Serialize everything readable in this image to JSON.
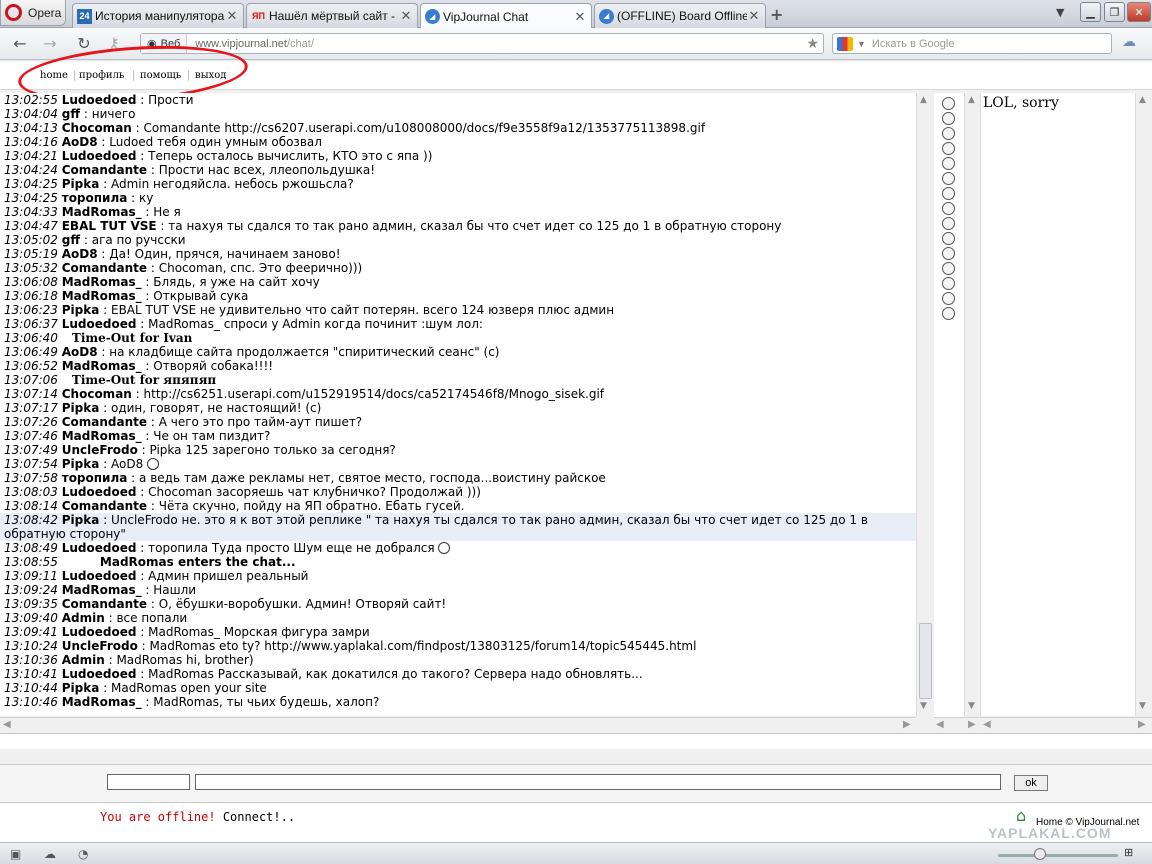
{
  "browser": {
    "menu_label": "Opera",
    "tabs": [
      {
        "icon": "24",
        "label": "История манипулятора ..."
      },
      {
        "icon": "ЯП",
        "label": "Нашёл мёртвый сайт - ..."
      },
      {
        "icon": "vj",
        "label": "VipJournal Chat"
      },
      {
        "icon": "vj",
        "label": "(OFFLINE) Board Offline ..."
      }
    ],
    "new_tab": "+",
    "tab_list": "▼",
    "address_badge": "Веб",
    "url_host": "www.vipjournal.net",
    "url_path": "/chat/",
    "search_placeholder": "Искать в Google",
    "zoom_label": "⊞"
  },
  "site_nav": {
    "home": "home",
    "profile": "профиль",
    "help": "помощь",
    "logout": "выход"
  },
  "chat": [
    {
      "time": "13:02:55",
      "user": "Ludoedoed",
      "text": " : Прости"
    },
    {
      "time": "13:04:04",
      "user": "gff",
      "text": " : ничего"
    },
    {
      "time": "13:04:13",
      "user": "Chocoman",
      "text": " :  Comandante http://cs6207.userapi.com/u108008000/docs/f9e3558f9a12/1353775113898.gif"
    },
    {
      "time": "13:04:16",
      "user": "AoD8",
      "text": " : Ludoed тебя один умным обозвал"
    },
    {
      "time": "13:04:21",
      "user": "Ludoedoed",
      "text": " : Теперь осталось вычислить, КТО это с япа ))"
    },
    {
      "time": "13:04:24",
      "user": "Comandante",
      "text": " : Прости нас всех, ллеопольдушка!"
    },
    {
      "time": "13:04:25",
      "user": "Pipka",
      "text": " :  Admin негодяйсла. небось ржошьсла?"
    },
    {
      "time": "13:04:25",
      "user": "торопила",
      "text": " : ку"
    },
    {
      "time": "13:04:33",
      "user": "MadRomas_",
      "text": " : Не я"
    },
    {
      "time": "13:04:47",
      "user": "EBAL TUT VSE",
      "text": " : та нахуя ты сдался то так рано админ, сказал бы что счет идет со 125 до 1 в обратную сторону"
    },
    {
      "time": "13:05:02",
      "user": "gff",
      "text": " : ага по ручсски"
    },
    {
      "time": "13:05:19",
      "user": "AoD8",
      "text": " : Да! Один, прячся, начинаем заново!"
    },
    {
      "time": "13:05:32",
      "user": "Comandante",
      "text": " :  Chocoman, спс. Это феерично)))"
    },
    {
      "time": "13:06:08",
      "user": "MadRomas_",
      "text": " : Блядь, я уже на сайт хочу"
    },
    {
      "time": "13:06:18",
      "user": "MadRomas_",
      "text": " : Открывай сука"
    },
    {
      "time": "13:06:23",
      "user": "Pipka",
      "text": " :  EBAL TUT VSE не удивительно что сайт потерян. всего 124 юзверя плюс админ"
    },
    {
      "time": "13:06:37",
      "user": "Ludoedoed",
      "text": " :  MadRomas_ спроси у Admin когда починит :шум лол:"
    },
    {
      "time": "13:06:40",
      "system": "Time-Out for Ivan"
    },
    {
      "time": "13:06:49",
      "user": "AoD8",
      "text": " : на кладбище сайта продолжается \"спиритический сеанс\" (с)"
    },
    {
      "time": "13:06:52",
      "user": "MadRomas_",
      "text": " : Отворяй собака!!!!"
    },
    {
      "time": "13:07:06",
      "system": "Time-Out for япяпяп"
    },
    {
      "time": "13:07:14",
      "user": "Chocoman",
      "text": " : http://cs6251.userapi.com/u152919514/docs/ca52174546f8/Mnogo_sisek.gif"
    },
    {
      "time": "13:07:17",
      "user": "Pipka",
      "text": " : один, говорят, не настоящий! (с)"
    },
    {
      "time": "13:07:26",
      "user": "Comandante",
      "text": " : А чего это про тайм-аут пишет?"
    },
    {
      "time": "13:07:46",
      "user": "MadRomas_",
      "text": " : Че он там пиздит?"
    },
    {
      "time": "13:07:49",
      "user": "UncleFrodo",
      "text": " :  Pipka 125 зарегоно только за сегодня?"
    },
    {
      "time": "13:07:54",
      "user": "Pipka",
      "text": " :  AoD8 ",
      "smile": true
    },
    {
      "time": "13:07:58",
      "user": "торопила",
      "text": " : а ведь там даже рекламы нет, святое место, господа...воистину райское"
    },
    {
      "time": "13:08:03",
      "user": "Ludoedoed",
      "text": " :  Chocoman засоряешь чат клубничко? Продолжай )))"
    },
    {
      "time": "13:08:14",
      "user": "Comandante",
      "text": " : Чёта скучно, пойду на ЯП обратно. Ебать гусей."
    },
    {
      "time": "13:08:42",
      "user": "Pipka",
      "text": " :  UncleFrodo не. это я к вот этой реплике \" та нахуя ты сдался то так рано админ, сказал бы что счет идет со 125 до 1 в обратную сторону\"",
      "highlight": true
    },
    {
      "time": "13:08:49",
      "user": "Ludoedoed",
      "text": " :  торопила Туда просто Шум еще не добрался ",
      "smile": true
    },
    {
      "time": "13:08:55",
      "enter": "MadRomas enters the chat..."
    },
    {
      "time": "13:09:11",
      "user": "Ludoedoed",
      "text": " : Админ пришел реальный"
    },
    {
      "time": "13:09:24",
      "user": "MadRomas_",
      "text": " : Нашли"
    },
    {
      "time": "13:09:35",
      "user": "Comandante",
      "text": " : О, ёбушки-воробушки. Админ! Отворяй сайт!"
    },
    {
      "time": "13:09:40",
      "user": "Admin",
      "text": " : все попали"
    },
    {
      "time": "13:09:41",
      "user": "Ludoedoed",
      "text": " :  MadRomas_ Морская фигура замри"
    },
    {
      "time": "13:10:24",
      "user": "UncleFrodo",
      "text": " :  MadRomas eto ty? http://www.yaplakal.com/findpost/13803125/forum14/topic545445.html"
    },
    {
      "time": "13:10:36",
      "user": "Admin",
      "text": " :  MadRomas hi, brother)"
    },
    {
      "time": "13:10:41",
      "user": "Ludoedoed",
      "text": " :  MadRomas Рассказывай, как докатился до такого? Сервера надо обновлять..."
    },
    {
      "time": "13:10:44",
      "user": "Pipka",
      "text": " :  MadRomas open your site"
    },
    {
      "time": "13:10:46",
      "user": "MadRomas_",
      "text": " : MadRomas, ты чьих будешь, халоп?"
    }
  ],
  "users_panel": {
    "text": "LOL, sorry"
  },
  "input": {
    "send_label": "ok"
  },
  "status": {
    "offline": "You are offline!",
    "connect": " Connect!.."
  },
  "footer": {
    "home_text": "Home © VipJournal.net",
    "watermark": "YAPLAKAL.COM"
  }
}
